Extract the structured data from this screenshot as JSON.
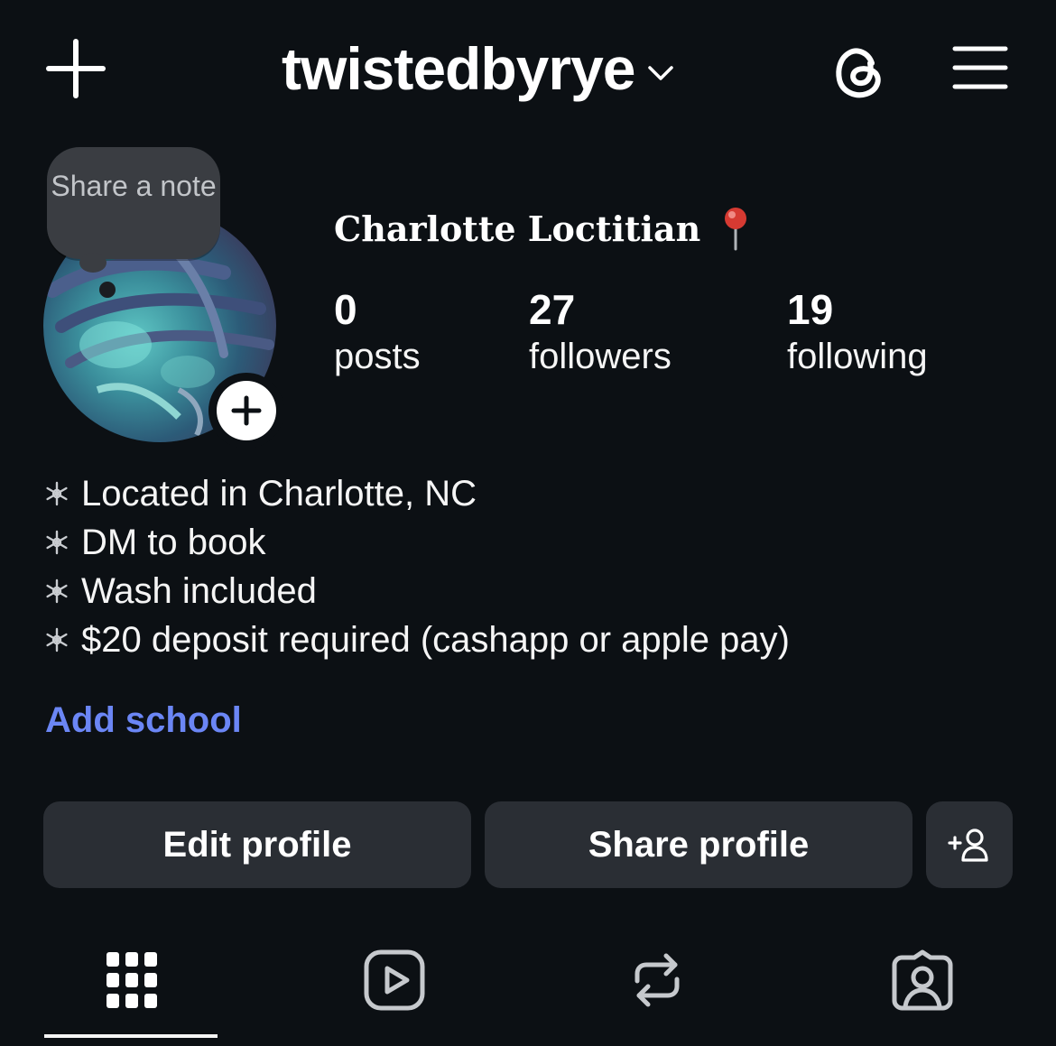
{
  "header": {
    "username": "twistedbyrye",
    "icons": {
      "create": "plus-icon",
      "switch_account": "chevron-down-icon",
      "threads": "threads-icon",
      "menu": "hamburger-menu-icon"
    }
  },
  "note": {
    "text": "Share a note"
  },
  "profile": {
    "display_name": "Charlotte Loctitian",
    "name_emoji": "round-pushpin-icon",
    "stats": [
      {
        "value": "0",
        "label": "posts"
      },
      {
        "value": "27",
        "label": "followers"
      },
      {
        "value": "19",
        "label": "following"
      }
    ]
  },
  "bio": {
    "bullet_icon": "snowflake-icon",
    "lines": [
      "Located in Charlotte, NC",
      "DM to book",
      "Wash included",
      "$20 deposit required (cashapp or apple pay)"
    ]
  },
  "add_school": "Add school",
  "buttons": {
    "edit_profile": "Edit profile",
    "share_profile": "Share profile",
    "discover_people_icon": "add-person-icon"
  },
  "tabs": [
    {
      "icon": "grid-icon",
      "active": true
    },
    {
      "icon": "reels-icon",
      "active": false
    },
    {
      "icon": "repost-icon",
      "active": false
    },
    {
      "icon": "tagged-icon",
      "active": false
    }
  ],
  "colors": {
    "background": "#0c1014",
    "button": "#2a2e34",
    "link": "#6b86f5",
    "note_bubble": "#3a3d42"
  }
}
